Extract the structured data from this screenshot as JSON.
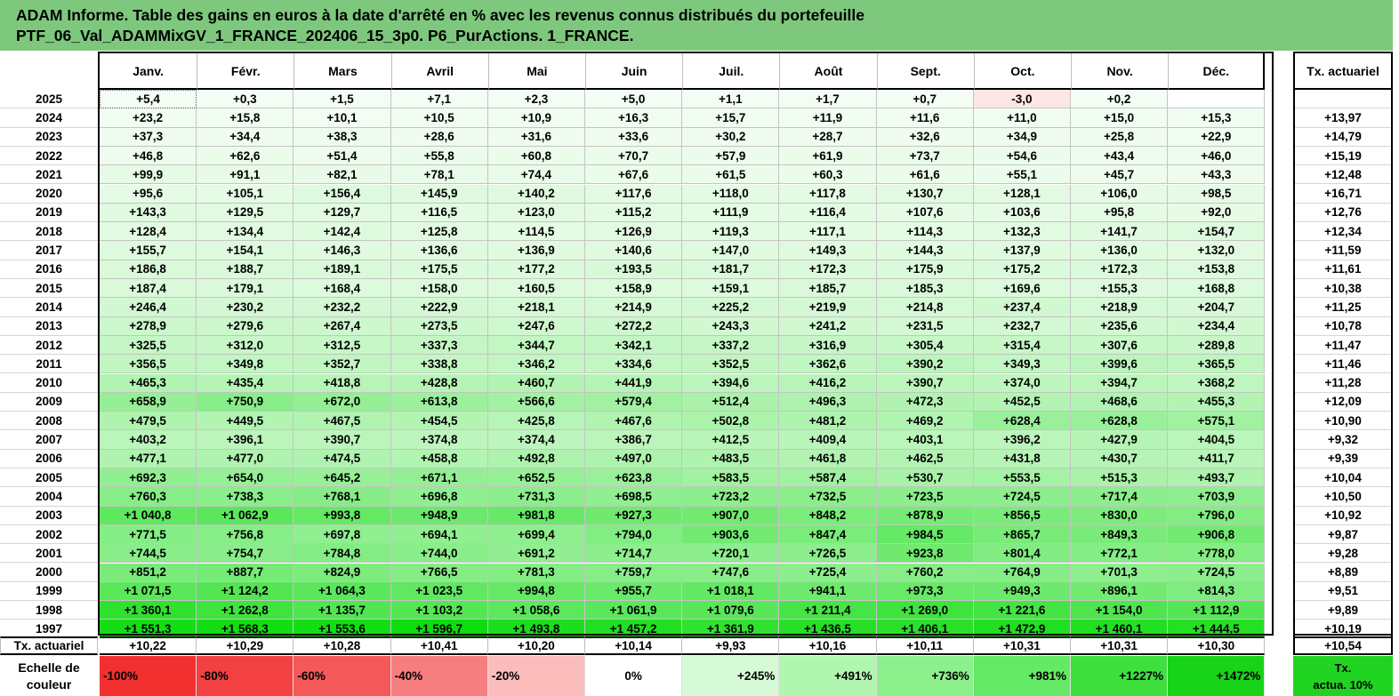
{
  "title": {
    "line1": "ADAM Informe. Table des gains en euros à la date d'arrêté en % avec les revenus connus distribués du portefeuille",
    "line2": "PTF_06_Val_ADAMMixGV_1_FRANCE_202406_15_3p0. P6_PurActions. 1_FRANCE."
  },
  "months": [
    "Janv.",
    "Févr.",
    "Mars",
    "Avril",
    "Mai",
    "Juin",
    "Juil.",
    "Août",
    "Sept.",
    "Oct.",
    "Nov.",
    "Déc."
  ],
  "tx_header": "Tx. actuariel",
  "rows": [
    {
      "year": "2025",
      "values": [
        "+5,4",
        "+0,3",
        "+1,5",
        "+7,1",
        "+2,3",
        "+5,0",
        "+1,1",
        "+1,7",
        "+0,7",
        "-3,0",
        "+0,2",
        ""
      ],
      "tx": ""
    },
    {
      "year": "2024",
      "values": [
        "+23,2",
        "+15,8",
        "+10,1",
        "+10,5",
        "+10,9",
        "+16,3",
        "+15,7",
        "+11,9",
        "+11,6",
        "+11,0",
        "+15,0",
        "+15,3"
      ],
      "tx": "+13,97"
    },
    {
      "year": "2023",
      "values": [
        "+37,3",
        "+34,4",
        "+38,3",
        "+28,6",
        "+31,6",
        "+33,6",
        "+30,2",
        "+28,7",
        "+32,6",
        "+34,9",
        "+25,8",
        "+22,9"
      ],
      "tx": "+14,79"
    },
    {
      "year": "2022",
      "values": [
        "+46,8",
        "+62,6",
        "+51,4",
        "+55,8",
        "+60,8",
        "+70,7",
        "+57,9",
        "+61,9",
        "+73,7",
        "+54,6",
        "+43,4",
        "+46,0"
      ],
      "tx": "+15,19"
    },
    {
      "year": "2021",
      "values": [
        "+99,9",
        "+91,1",
        "+82,1",
        "+78,1",
        "+74,4",
        "+67,6",
        "+61,5",
        "+60,3",
        "+61,6",
        "+55,1",
        "+45,7",
        "+43,3"
      ],
      "tx": "+12,48"
    },
    {
      "year": "2020",
      "values": [
        "+95,6",
        "+105,1",
        "+156,4",
        "+145,9",
        "+140,2",
        "+117,6",
        "+118,0",
        "+117,8",
        "+130,7",
        "+128,1",
        "+106,0",
        "+98,5"
      ],
      "tx": "+16,71"
    },
    {
      "year": "2019",
      "values": [
        "+143,3",
        "+129,5",
        "+129,7",
        "+116,5",
        "+123,0",
        "+115,2",
        "+111,9",
        "+116,4",
        "+107,6",
        "+103,6",
        "+95,8",
        "+92,0"
      ],
      "tx": "+12,76"
    },
    {
      "year": "2018",
      "values": [
        "+128,4",
        "+134,4",
        "+142,4",
        "+125,8",
        "+114,5",
        "+126,9",
        "+119,3",
        "+117,1",
        "+114,3",
        "+132,3",
        "+141,7",
        "+154,7"
      ],
      "tx": "+12,34"
    },
    {
      "year": "2017",
      "values": [
        "+155,7",
        "+154,1",
        "+146,3",
        "+136,6",
        "+136,9",
        "+140,6",
        "+147,0",
        "+149,3",
        "+144,3",
        "+137,9",
        "+136,0",
        "+132,0"
      ],
      "tx": "+11,59"
    },
    {
      "year": "2016",
      "values": [
        "+186,8",
        "+188,7",
        "+189,1",
        "+175,5",
        "+177,2",
        "+193,5",
        "+181,7",
        "+172,3",
        "+175,9",
        "+175,2",
        "+172,3",
        "+153,8"
      ],
      "tx": "+11,61"
    },
    {
      "year": "2015",
      "values": [
        "+187,4",
        "+179,1",
        "+168,4",
        "+158,0",
        "+160,5",
        "+158,9",
        "+159,1",
        "+185,7",
        "+185,3",
        "+169,6",
        "+155,3",
        "+168,8"
      ],
      "tx": "+10,38"
    },
    {
      "year": "2014",
      "values": [
        "+246,4",
        "+230,2",
        "+232,2",
        "+222,9",
        "+218,1",
        "+214,9",
        "+225,2",
        "+219,9",
        "+214,8",
        "+237,4",
        "+218,9",
        "+204,7"
      ],
      "tx": "+11,25"
    },
    {
      "year": "2013",
      "values": [
        "+278,9",
        "+279,6",
        "+267,4",
        "+273,5",
        "+247,6",
        "+272,2",
        "+243,3",
        "+241,2",
        "+231,5",
        "+232,7",
        "+235,6",
        "+234,4"
      ],
      "tx": "+10,78"
    },
    {
      "year": "2012",
      "values": [
        "+325,5",
        "+312,0",
        "+312,5",
        "+337,3",
        "+344,7",
        "+342,1",
        "+337,2",
        "+316,9",
        "+305,4",
        "+315,4",
        "+307,6",
        "+289,8"
      ],
      "tx": "+11,47"
    },
    {
      "year": "2011",
      "values": [
        "+356,5",
        "+349,8",
        "+352,7",
        "+338,8",
        "+346,2",
        "+334,6",
        "+352,5",
        "+362,6",
        "+390,2",
        "+349,3",
        "+399,6",
        "+365,5"
      ],
      "tx": "+11,46"
    },
    {
      "year": "2010",
      "values": [
        "+465,3",
        "+435,4",
        "+418,8",
        "+428,8",
        "+460,7",
        "+441,9",
        "+394,6",
        "+416,2",
        "+390,7",
        "+374,0",
        "+394,7",
        "+368,2"
      ],
      "tx": "+11,28"
    },
    {
      "year": "2009",
      "values": [
        "+658,9",
        "+750,9",
        "+672,0",
        "+613,8",
        "+566,6",
        "+579,4",
        "+512,4",
        "+496,3",
        "+472,3",
        "+452,5",
        "+468,6",
        "+455,3"
      ],
      "tx": "+12,09"
    },
    {
      "year": "2008",
      "values": [
        "+479,5",
        "+449,5",
        "+467,5",
        "+454,5",
        "+425,8",
        "+467,6",
        "+502,8",
        "+481,2",
        "+469,2",
        "+628,4",
        "+628,8",
        "+575,1"
      ],
      "tx": "+10,90"
    },
    {
      "year": "2007",
      "values": [
        "+403,2",
        "+396,1",
        "+390,7",
        "+374,8",
        "+374,4",
        "+386,7",
        "+412,5",
        "+409,4",
        "+403,1",
        "+396,2",
        "+427,9",
        "+404,5"
      ],
      "tx": "+9,32"
    },
    {
      "year": "2006",
      "values": [
        "+477,1",
        "+477,0",
        "+474,5",
        "+458,8",
        "+492,8",
        "+497,0",
        "+483,5",
        "+461,8",
        "+462,5",
        "+431,8",
        "+430,7",
        "+411,7"
      ],
      "tx": "+9,39"
    },
    {
      "year": "2005",
      "values": [
        "+692,3",
        "+654,0",
        "+645,2",
        "+671,1",
        "+652,5",
        "+623,8",
        "+583,5",
        "+587,4",
        "+530,7",
        "+553,5",
        "+515,3",
        "+493,7"
      ],
      "tx": "+10,04"
    },
    {
      "year": "2004",
      "values": [
        "+760,3",
        "+738,3",
        "+768,1",
        "+696,8",
        "+731,3",
        "+698,5",
        "+723,2",
        "+732,5",
        "+723,5",
        "+724,5",
        "+717,4",
        "+703,9"
      ],
      "tx": "+10,50"
    },
    {
      "year": "2003",
      "values": [
        "+1 040,8",
        "+1 062,9",
        "+993,8",
        "+948,9",
        "+981,8",
        "+927,3",
        "+907,0",
        "+848,2",
        "+878,9",
        "+856,5",
        "+830,0",
        "+796,0"
      ],
      "tx": "+10,92"
    },
    {
      "year": "2002",
      "values": [
        "+771,5",
        "+756,8",
        "+697,8",
        "+694,1",
        "+699,4",
        "+794,0",
        "+903,6",
        "+847,4",
        "+984,5",
        "+865,7",
        "+849,3",
        "+906,8"
      ],
      "tx": "+9,87"
    },
    {
      "year": "2001",
      "values": [
        "+744,5",
        "+754,7",
        "+784,8",
        "+744,0",
        "+691,2",
        "+714,7",
        "+720,1",
        "+726,5",
        "+923,8",
        "+801,4",
        "+772,1",
        "+778,0"
      ],
      "tx": "+9,28"
    },
    {
      "year": "2000",
      "values": [
        "+851,2",
        "+887,7",
        "+824,9",
        "+766,5",
        "+781,3",
        "+759,7",
        "+747,6",
        "+725,4",
        "+760,2",
        "+764,9",
        "+701,3",
        "+724,5"
      ],
      "tx": "+8,89"
    },
    {
      "year": "1999",
      "values": [
        "+1 071,5",
        "+1 124,2",
        "+1 064,3",
        "+1 023,5",
        "+994,8",
        "+955,7",
        "+1 018,1",
        "+941,1",
        "+973,3",
        "+949,3",
        "+896,1",
        "+814,3"
      ],
      "tx": "+9,51"
    },
    {
      "year": "1998",
      "values": [
        "+1 360,1",
        "+1 262,8",
        "+1 135,7",
        "+1 103,2",
        "+1 058,6",
        "+1 061,9",
        "+1 079,6",
        "+1 211,4",
        "+1 269,0",
        "+1 221,6",
        "+1 154,0",
        "+1 112,9"
      ],
      "tx": "+9,89"
    },
    {
      "year": "1997",
      "values": [
        "+1 551,3",
        "+1 568,3",
        "+1 553,6",
        "+1 596,7",
        "+1 493,8",
        "+1 457,2",
        "+1 361,9",
        "+1 436,5",
        "+1 406,1",
        "+1 472,9",
        "+1 460,1",
        "+1 444,5"
      ],
      "tx": "+10,19"
    }
  ],
  "averages": {
    "label": "Tx. actuariel",
    "values": [
      "+10,22",
      "+10,29",
      "+10,28",
      "+10,41",
      "+10,20",
      "+10,14",
      "+9,93",
      "+10,16",
      "+10,11",
      "+10,31",
      "+10,31",
      "+10,30"
    ],
    "tx": "+10,54"
  },
  "scale": {
    "label_line1": "Echelle de",
    "label_line2": "couleur",
    "steps": [
      {
        "label": "-100%",
        "color": "#f23030",
        "align": "left"
      },
      {
        "label": "-80%",
        "color": "#f34040",
        "align": "left"
      },
      {
        "label": "-60%",
        "color": "#f45858",
        "align": "left"
      },
      {
        "label": "-40%",
        "color": "#f77e7e",
        "align": "left"
      },
      {
        "label": "-20%",
        "color": "#fbbcbc",
        "align": "left"
      },
      {
        "label": "0%",
        "color": "#ffffff",
        "align": "center"
      },
      {
        "label": "+245%",
        "color": "#d6fad6",
        "align": "right"
      },
      {
        "label": "+491%",
        "color": "#b0f6b0",
        "align": "right"
      },
      {
        "label": "+736%",
        "color": "#8cf08c",
        "align": "right"
      },
      {
        "label": "+981%",
        "color": "#64ea64",
        "align": "right"
      },
      {
        "label": "+1227%",
        "color": "#3ee03e",
        "align": "right"
      },
      {
        "label": "+1472%",
        "color": "#18d418",
        "align": "right"
      }
    ],
    "tx_line1": "Tx.",
    "tx_line2": "actua. 10%",
    "tx_color": "#22d422"
  },
  "colors": {
    "title_bg": "#7ec87e",
    "negative_tint": "#fde6e6"
  }
}
